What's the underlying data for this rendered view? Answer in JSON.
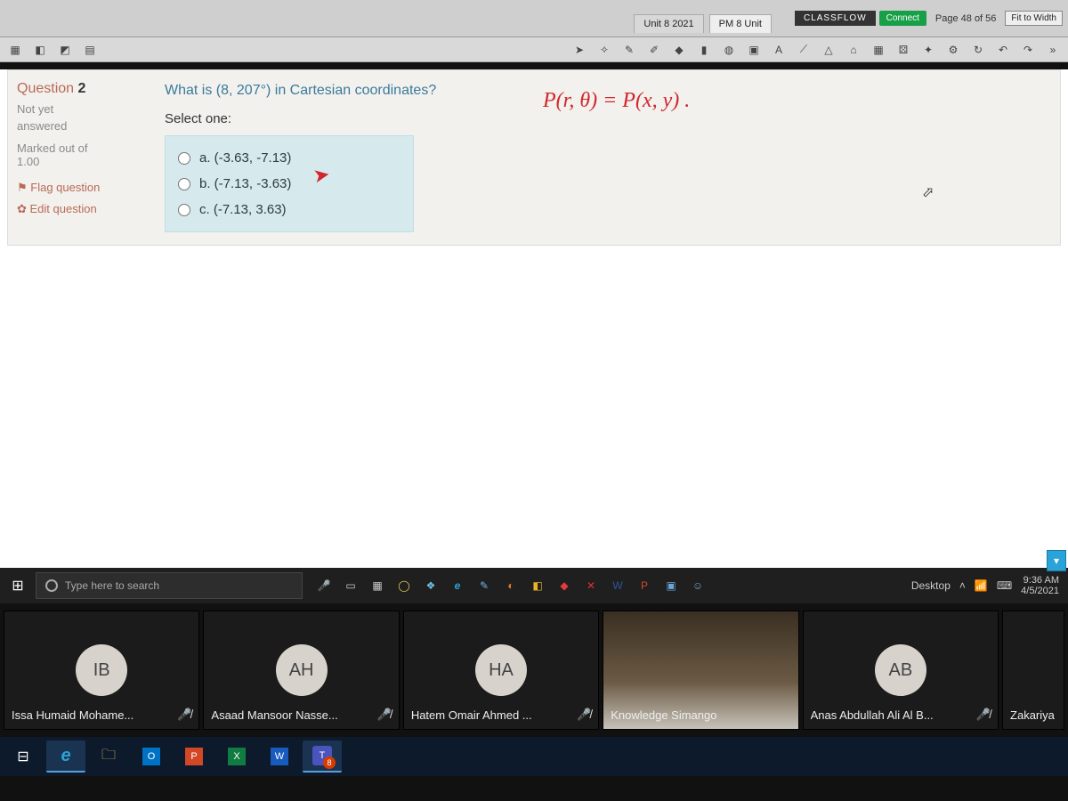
{
  "topbar": {
    "tab1": "Unit 8 2021",
    "tab2": "PM 8 Unit",
    "classflow": "CLASSFLOW",
    "connect": "Connect",
    "page_of": "Page 48 of 56",
    "fit": "Fit to Width"
  },
  "question": {
    "label_prefix": "Question ",
    "number": "2",
    "status1": "Not yet",
    "status2": "answered",
    "marked_label": "Marked out of",
    "marked_value": "1.00",
    "flag": "Flag question",
    "edit": "Edit question",
    "prompt": "What is (8, 207°) in Cartesian coordinates?",
    "select_one": "Select one:",
    "opts": {
      "a": "a. (-3.63, -7.13)",
      "b": "b. (-7.13, -3.63)",
      "c": "c. (-7.13, 3.63)"
    }
  },
  "annotation": {
    "formula": "P(r, θ) = P(x, y) .",
    "mark": "➤"
  },
  "win_taskbar": {
    "search_placeholder": "Type here to search",
    "desktop_label": "Desktop",
    "time": "9:36 AM",
    "date": "4/5/2021"
  },
  "participants": {
    "p0": {
      "initials": "IB",
      "name": "Issa Humaid Mohame..."
    },
    "p1": {
      "initials": "AH",
      "name": "Asaad Mansoor Nasse..."
    },
    "p2": {
      "initials": "HA",
      "name": "Hatem Omair Ahmed ..."
    },
    "p3": {
      "name": "Knowledge Simango"
    },
    "p4": {
      "initials": "AB",
      "name": "Anas Abdullah Ali Al B..."
    },
    "p5": {
      "name": "Zakariya"
    }
  },
  "os": {
    "teams_badge": "8"
  }
}
